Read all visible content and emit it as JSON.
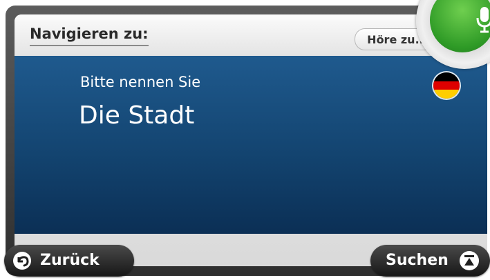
{
  "header": {
    "title": "Navigieren zu:",
    "listen_button_label": "Höre zu..."
  },
  "prompt": {
    "instruction": "Bitte nennen Sie",
    "field": "Die Stadt",
    "country_flag": "germany-flag-icon"
  },
  "mic": {
    "icon": "microphone-icon",
    "color": "#3aa52f"
  },
  "footer": {
    "back_label": "Zurück",
    "back_icon": "back-arrow-icon",
    "search_label": "Suchen",
    "search_icon": "keyboard-icon"
  },
  "colors": {
    "panel_blue_top": "#1f5a8e",
    "panel_blue_bottom": "#0b2f55",
    "button_dark": "#1e1e1e"
  }
}
